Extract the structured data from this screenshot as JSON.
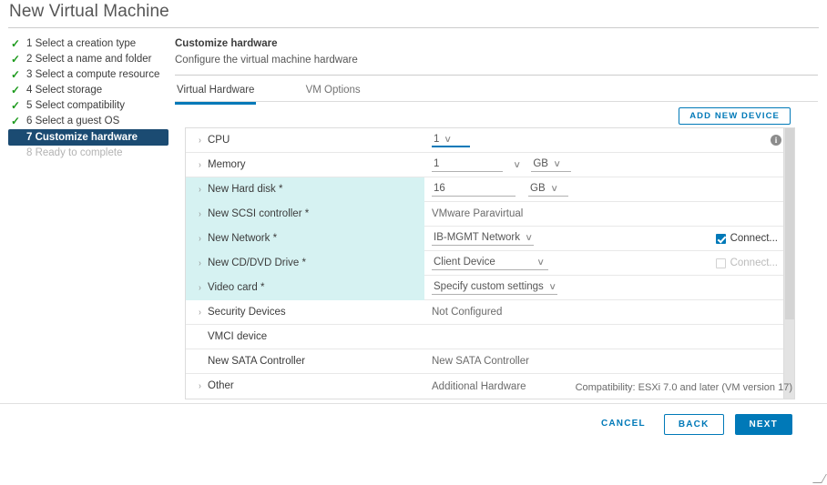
{
  "window": {
    "title": "New Virtual Machine"
  },
  "steps": [
    {
      "num": "1",
      "label": "1 Select a creation type",
      "state": "done"
    },
    {
      "num": "2",
      "label": "2 Select a name and folder",
      "state": "done"
    },
    {
      "num": "3",
      "label": "3 Select a compute resource",
      "state": "done"
    },
    {
      "num": "4",
      "label": "4 Select storage",
      "state": "done"
    },
    {
      "num": "5",
      "label": "5 Select compatibility",
      "state": "done"
    },
    {
      "num": "6",
      "label": "6 Select a guest OS",
      "state": "done"
    },
    {
      "num": "7",
      "label": "7 Customize hardware",
      "state": "current"
    },
    {
      "num": "8",
      "label": "8 Ready to complete",
      "state": "pending"
    }
  ],
  "panel": {
    "heading": "Customize hardware",
    "subheading": "Configure the virtual machine hardware"
  },
  "tabs": [
    {
      "label": "Virtual Hardware",
      "active": true
    },
    {
      "label": "VM Options",
      "active": false
    }
  ],
  "toolbar": {
    "add_new_device_label": "ADD NEW DEVICE"
  },
  "hardware_rows": [
    {
      "label": "CPU",
      "expandable": true,
      "new": false,
      "value_kind": "dropdown",
      "value": "1",
      "focused": true,
      "info_icon": true
    },
    {
      "label": "Memory",
      "expandable": true,
      "new": false,
      "value_kind": "number_unit_wide",
      "value": "1",
      "unit": "GB"
    },
    {
      "label": "New Hard disk *",
      "expandable": true,
      "new": true,
      "value_kind": "number_unit",
      "value": "16",
      "unit": "GB"
    },
    {
      "label": "New SCSI controller *",
      "expandable": true,
      "new": true,
      "value_kind": "plain",
      "value": "VMware Paravirtual"
    },
    {
      "label": "New Network *",
      "expandable": true,
      "new": true,
      "value_kind": "dropdown",
      "value": "IB-MGMT Network",
      "checkbox": {
        "label": "Connect...",
        "checked": true,
        "disabled": false
      }
    },
    {
      "label": "New CD/DVD Drive *",
      "expandable": true,
      "new": true,
      "value_kind": "dropdown_wide",
      "value": "Client Device",
      "checkbox": {
        "label": "Connect...",
        "checked": false,
        "disabled": true
      }
    },
    {
      "label": "Video card *",
      "expandable": true,
      "new": true,
      "value_kind": "dropdown",
      "value": "Specify custom settings"
    },
    {
      "label": "Security Devices",
      "expandable": true,
      "new": false,
      "value_kind": "plain",
      "value": "Not Configured"
    },
    {
      "label": "VMCI device",
      "expandable": false,
      "new": false,
      "value_kind": "plain",
      "value": ""
    },
    {
      "label": "New SATA Controller",
      "expandable": false,
      "new": false,
      "value_kind": "plain",
      "value": "New SATA Controller"
    },
    {
      "label": "Other",
      "expandable": true,
      "new": false,
      "value_kind": "plain",
      "value": "Additional Hardware"
    }
  ],
  "footer": {
    "compatibility": "Compatibility: ESXi 7.0 and later (VM version 17)",
    "cancel_label": "CANCEL",
    "back_label": "BACK",
    "next_label": "NEXT"
  },
  "icons": {
    "check": "✓",
    "caret_right": "›",
    "chevron_down": "∨",
    "info": "i"
  },
  "colors": {
    "accent": "#0079b8",
    "current_step_bg": "#1b4b72",
    "new_device_row": "#d6f2f2",
    "check_green": "#1d9a1d"
  }
}
